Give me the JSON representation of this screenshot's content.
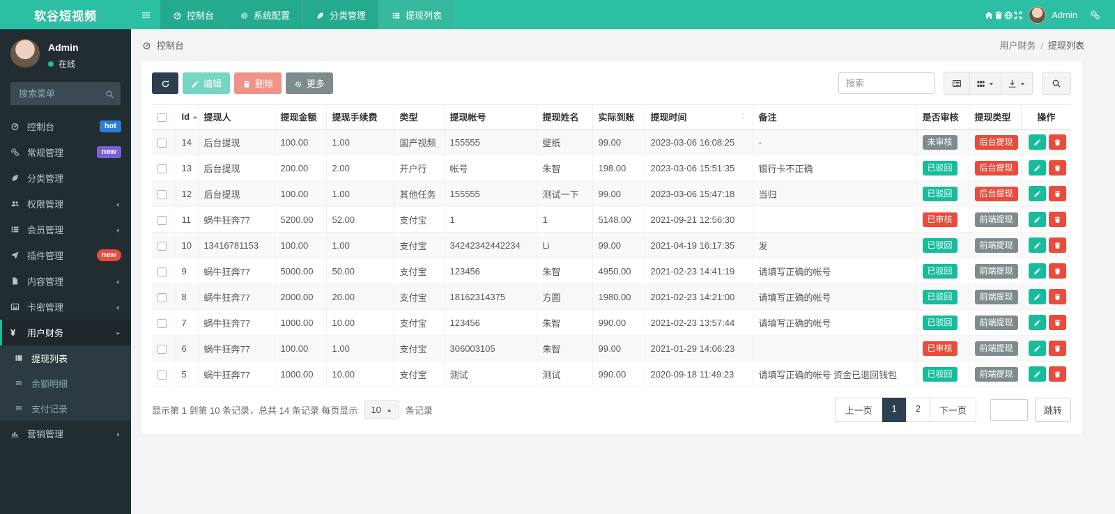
{
  "brand": "软谷短视频",
  "colors": {
    "navbar": "#2dbfa3",
    "accent": "#18bc9c",
    "sidebar": "#222d32",
    "danger": "#e74c3c",
    "dark": "#2c3e50",
    "muted": "#7f8c8d",
    "hot_badge": "#2d7dd2",
    "new_badge_purple": "#7a60d8",
    "new_badge_red": "#e74c3c"
  },
  "topnav": {
    "tabs": [
      {
        "label": "控制台",
        "icon": "dashboard-icon",
        "active": false
      },
      {
        "label": "系统配置",
        "icon": "gear-icon",
        "active": false
      },
      {
        "label": "分类管理",
        "icon": "leaf-icon",
        "active": false
      },
      {
        "label": "提现列表",
        "icon": "list-icon",
        "active": true
      }
    ],
    "right_icons": [
      "home-icon",
      "trash-icon",
      "language-icon",
      "fullscreen-icon"
    ],
    "user_name": "Admin",
    "settings_icon": "gears-icon"
  },
  "sidebar": {
    "user": {
      "name": "Admin",
      "status": "在线"
    },
    "search_placeholder": "搜索菜单",
    "menu": [
      {
        "label": "控制台",
        "icon": "dashboard-icon",
        "badge": {
          "text": "hot",
          "color": "#2d7dd2",
          "shape": "square"
        }
      },
      {
        "label": "常规管理",
        "icon": "gears-icon",
        "badge": {
          "text": "new",
          "color": "#7a60d8",
          "shape": "square"
        }
      },
      {
        "label": "分类管理",
        "icon": "leaf-icon"
      },
      {
        "label": "权限管理",
        "icon": "users-icon",
        "chevron": "left"
      },
      {
        "label": "会员管理",
        "icon": "list-icon",
        "chevron": "left"
      },
      {
        "label": "插件管理",
        "icon": "plane-icon",
        "badge": {
          "text": "new",
          "color": "#e74c3c",
          "shape": "pill"
        }
      },
      {
        "label": "内容管理",
        "icon": "file-icon",
        "chevron": "left"
      },
      {
        "label": "卡密管理",
        "icon": "image-icon",
        "chevron": "left"
      },
      {
        "label": "用户财务",
        "icon": "yen-icon",
        "chevron": "down",
        "active": true,
        "children": [
          {
            "label": "提现列表",
            "icon": "list-icon",
            "active": true
          },
          {
            "label": "余额明细",
            "icon": "rows-icon"
          },
          {
            "label": "支付记录",
            "icon": "rows-icon"
          }
        ]
      },
      {
        "label": "营销管理",
        "icon": "chart-icon",
        "chevron": "left"
      }
    ]
  },
  "breadcrumb": {
    "left": "控制台",
    "right": [
      "用户财务",
      "提现列表"
    ]
  },
  "toolbar": {
    "edit_label": "编辑",
    "delete_label": "删除",
    "more_label": "更多",
    "search_placeholder": "搜索"
  },
  "table": {
    "columns": [
      {
        "label": "Id",
        "sort": "desc"
      },
      {
        "label": "提现人"
      },
      {
        "label": "提现金额"
      },
      {
        "label": "提现手续费"
      },
      {
        "label": "类型"
      },
      {
        "label": "提现帐号"
      },
      {
        "label": "提现姓名"
      },
      {
        "label": "实际到账"
      },
      {
        "label": "提现时间",
        "sort": "both"
      },
      {
        "label": "备注"
      },
      {
        "label": "是否审核"
      },
      {
        "label": "提现类型"
      },
      {
        "label": "操作"
      }
    ],
    "rows": [
      {
        "id": "14",
        "withdrawer": "后台提现",
        "amount": "100.00",
        "fee": "1.00",
        "type": "国产视频",
        "account": "155555",
        "payee": "壁纸",
        "actual": "99.00",
        "time": "2023-03-06 16:08:25",
        "remark": "-",
        "audit": {
          "text": "未审核",
          "style": "gray"
        },
        "wtype": {
          "text": "后台提现",
          "style": "red"
        }
      },
      {
        "id": "13",
        "withdrawer": "后台提现",
        "amount": "200.00",
        "fee": "2.00",
        "type": "开户行",
        "account": "帐号",
        "payee": "朱智",
        "actual": "198.00",
        "time": "2023-03-06 15:51:35",
        "remark": "银行卡不正确",
        "audit": {
          "text": "已驳回",
          "style": "green"
        },
        "wtype": {
          "text": "后台提现",
          "style": "red"
        }
      },
      {
        "id": "12",
        "withdrawer": "后台提现",
        "amount": "100.00",
        "fee": "1.00",
        "type": "其他任务",
        "account": "155555",
        "payee": "测试一下",
        "actual": "99.00",
        "time": "2023-03-06 15:47:18",
        "remark": "当归",
        "audit": {
          "text": "已驳回",
          "style": "green"
        },
        "wtype": {
          "text": "后台提现",
          "style": "red"
        }
      },
      {
        "id": "11",
        "withdrawer": "蜗牛狂奔77",
        "amount": "5200.00",
        "fee": "52.00",
        "type": "支付宝",
        "account": "1",
        "payee": "1",
        "actual": "5148.00",
        "time": "2021-09-21 12:56:30",
        "remark": "",
        "audit": {
          "text": "已审核",
          "style": "red"
        },
        "wtype": {
          "text": "前端提现",
          "style": "gray"
        }
      },
      {
        "id": "10",
        "withdrawer": "13416781153",
        "amount": "100.00",
        "fee": "1.00",
        "type": "支付宝",
        "account": "34242342442234",
        "payee": "Li",
        "actual": "99.00",
        "time": "2021-04-19 16:17:35",
        "remark": "发",
        "audit": {
          "text": "已驳回",
          "style": "green"
        },
        "wtype": {
          "text": "前端提现",
          "style": "gray"
        }
      },
      {
        "id": "9",
        "withdrawer": "蜗牛狂奔77",
        "amount": "5000.00",
        "fee": "50.00",
        "type": "支付宝",
        "account": "123456",
        "payee": "朱智",
        "actual": "4950.00",
        "time": "2021-02-23 14:41:19",
        "remark": "请填写正确的帐号",
        "audit": {
          "text": "已驳回",
          "style": "green"
        },
        "wtype": {
          "text": "前端提现",
          "style": "gray"
        }
      },
      {
        "id": "8",
        "withdrawer": "蜗牛狂奔77",
        "amount": "2000.00",
        "fee": "20.00",
        "type": "支付宝",
        "account": "18162314375",
        "payee": "方圆",
        "actual": "1980.00",
        "time": "2021-02-23 14:21:00",
        "remark": "请填写正确的帐号",
        "audit": {
          "text": "已驳回",
          "style": "green"
        },
        "wtype": {
          "text": "前端提现",
          "style": "gray"
        }
      },
      {
        "id": "7",
        "withdrawer": "蜗牛狂奔77",
        "amount": "1000.00",
        "fee": "10.00",
        "type": "支付宝",
        "account": "123456",
        "payee": "朱智",
        "actual": "990.00",
        "time": "2021-02-23 13:57:44",
        "remark": "请填写正确的帐号",
        "audit": {
          "text": "已驳回",
          "style": "green"
        },
        "wtype": {
          "text": "前端提现",
          "style": "gray"
        }
      },
      {
        "id": "6",
        "withdrawer": "蜗牛狂奔77",
        "amount": "100.00",
        "fee": "1.00",
        "type": "支付宝",
        "account": "306003105",
        "payee": "朱智",
        "actual": "99.00",
        "time": "2021-01-29 14:06:23",
        "remark": "",
        "audit": {
          "text": "已审核",
          "style": "red"
        },
        "wtype": {
          "text": "前端提现",
          "style": "gray"
        }
      },
      {
        "id": "5",
        "withdrawer": "蜗牛狂奔77",
        "amount": "1000.00",
        "fee": "10.00",
        "type": "支付宝",
        "account": "测试",
        "payee": "测试",
        "actual": "990.00",
        "time": "2020-09-18 11:49:23",
        "remark": "请填写正确的帐号 资金已退回钱包",
        "audit": {
          "text": "已驳回",
          "style": "green"
        },
        "wtype": {
          "text": "前端提现",
          "style": "gray"
        }
      }
    ]
  },
  "pager": {
    "summary_prefix": "显示第 1 到第 10 条记录，总共 14 条记录 每页显示",
    "per_page": "10",
    "summary_suffix": "条记录",
    "prev": "上一页",
    "pages": [
      "1",
      "2"
    ],
    "active_page": "1",
    "next": "下一页",
    "jump_label": "跳转"
  }
}
